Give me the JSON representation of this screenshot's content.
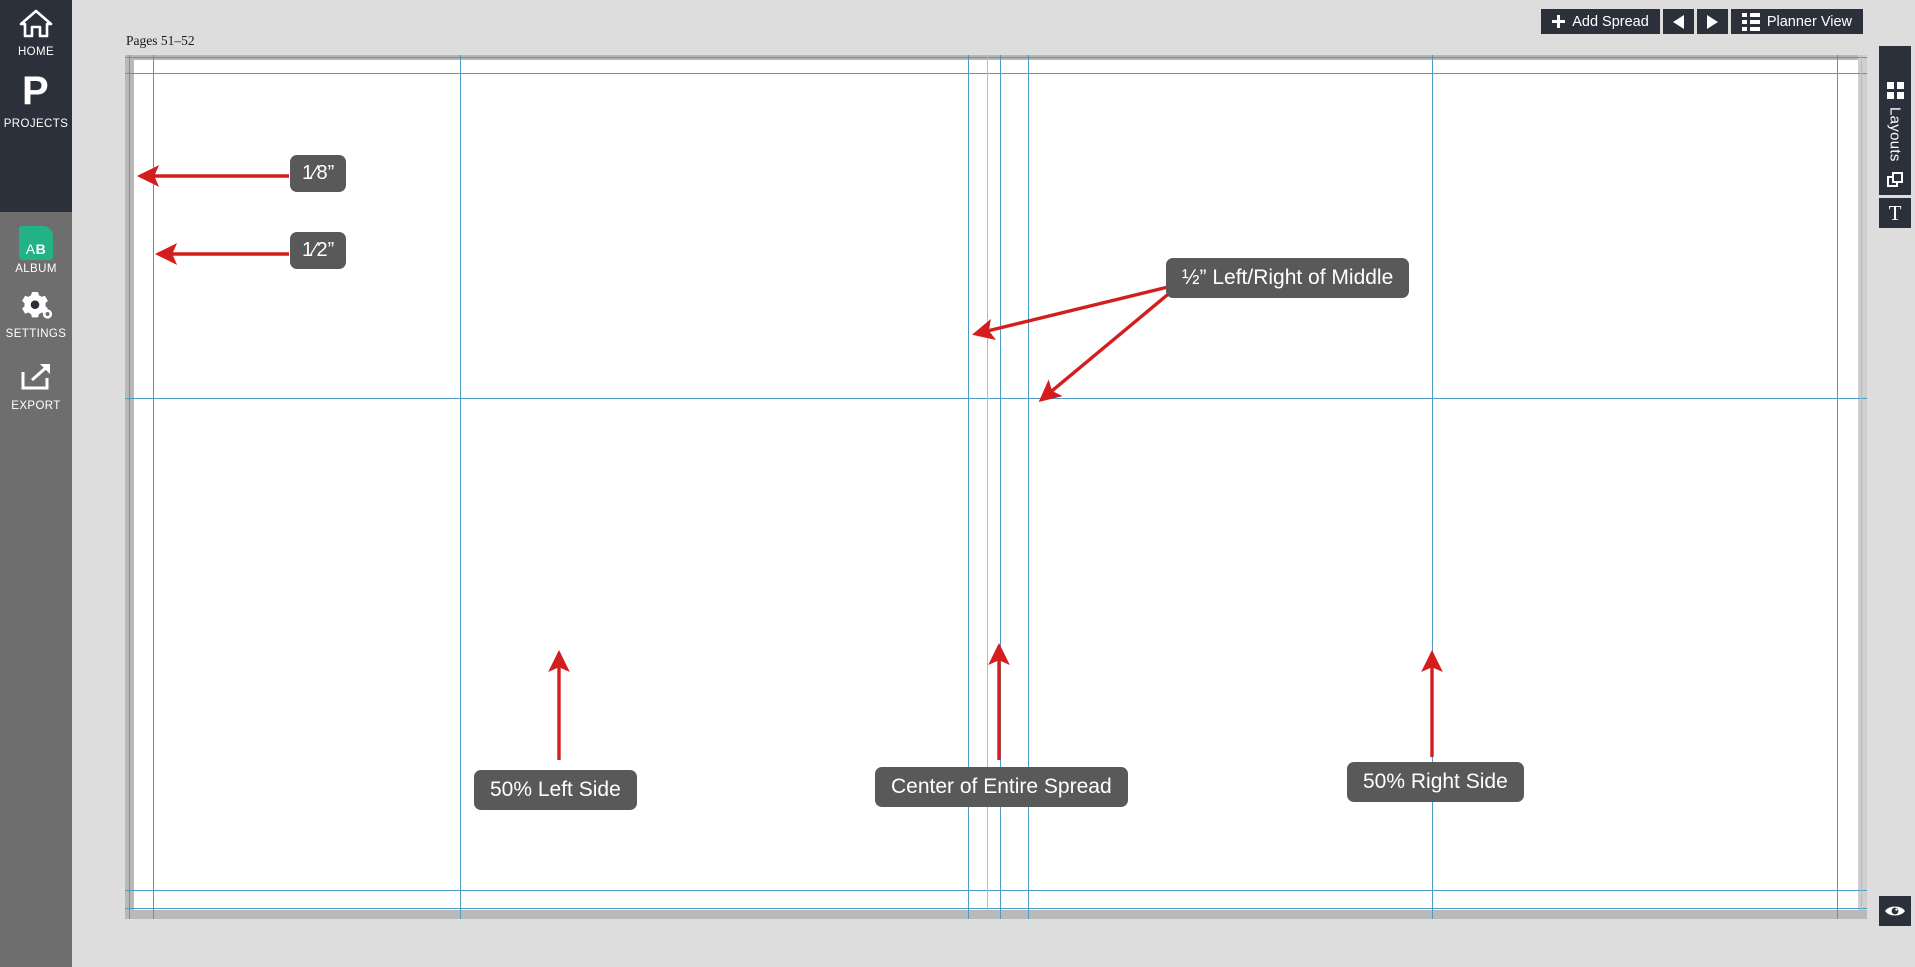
{
  "app": {
    "title": "Album Designer Spread Editor"
  },
  "left_nav": {
    "items": [
      {
        "id": "home",
        "label": "HOME",
        "icon": "home-icon"
      },
      {
        "id": "projects",
        "label": "PROJECTS",
        "icon": "projects-p-icon"
      },
      {
        "id": "album",
        "label": "ALBUM",
        "icon": "album-ab-icon",
        "badge": "AB",
        "color": "#22b286"
      },
      {
        "id": "settings",
        "label": "SETTINGS",
        "icon": "gear-icon"
      },
      {
        "id": "export",
        "label": "EXPORT",
        "icon": "export-share-icon"
      }
    ]
  },
  "toolbar": {
    "add_spread_label": "Add Spread",
    "prev_label": "",
    "next_label": "",
    "planner_view_label": "Planner View"
  },
  "canvas": {
    "page_label": "Pages 51–52"
  },
  "right_rail": {
    "layouts_label": "Layouts",
    "duplicate_label": "",
    "text_label": "T",
    "preview_label": ""
  },
  "annotations": [
    {
      "id": "eighth-inch",
      "text": "1⁄8”",
      "kind": "fraction",
      "num": "1",
      "den": "8",
      "suffix": "”"
    },
    {
      "id": "half-inch",
      "text": "1⁄2”",
      "kind": "fraction",
      "num": "1",
      "den": "2",
      "suffix": "”"
    },
    {
      "id": "half-inch-of-middle",
      "text": "½” Left/Right of Middle",
      "kind": "plain"
    },
    {
      "id": "fifty-left",
      "text": "50% Left Side",
      "kind": "plain"
    },
    {
      "id": "center-spread",
      "text": "Center of Entire Spread",
      "kind": "plain"
    },
    {
      "id": "fifty-right",
      "text": "50% Right Side",
      "kind": "plain"
    }
  ],
  "colors": {
    "nav_dark": "#2b303a",
    "nav_gray": "#6e6e6e",
    "album_green": "#22b286",
    "guide_blue": "#4b9bc4",
    "annotation_red": "#d41e1e",
    "callout_gray": "#595959",
    "app_background": "#dddddd"
  }
}
